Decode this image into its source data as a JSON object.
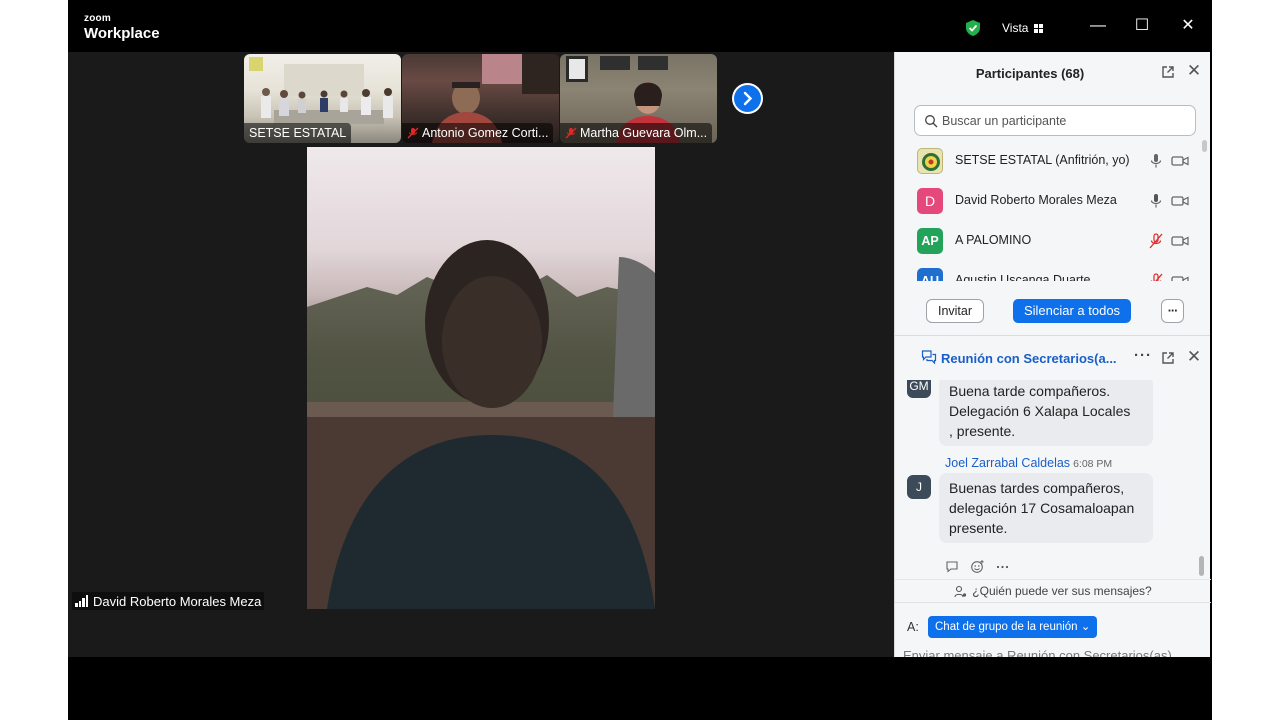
{
  "app": {
    "logo_top": "zoom",
    "logo_bottom": "Workplace",
    "view_label": "Vista",
    "minimize": "—",
    "maximize": "☐",
    "close": "✕",
    "accent_color": "#0e71eb",
    "secure_icon": "shield-check-icon"
  },
  "gallery": {
    "thumbnails": [
      {
        "name": "SETSE ESTATAL",
        "muted": false
      },
      {
        "name": "Antonio Gomez Corti...",
        "muted": true
      },
      {
        "name": "Martha Guevara Olm...",
        "muted": true
      }
    ],
    "next_icon": "chevron-right-icon"
  },
  "main_video": {
    "speaker_name": "David Roberto Morales Meza"
  },
  "participants": {
    "title": "Participantes (68)",
    "search_placeholder": "Buscar un participante",
    "list": [
      {
        "name": "SETSE ESTATAL (Anfitrión, yo)",
        "initials": "",
        "avatar_color": "#e9e3b0",
        "mic": "on",
        "video": "off"
      },
      {
        "name": "David Roberto Morales Meza",
        "initials": "D",
        "avatar_color": "#e5487a",
        "mic": "on",
        "video": "off"
      },
      {
        "name": "A PALOMINO",
        "initials": "AP",
        "avatar_color": "#23a35a",
        "mic": "muted",
        "video": "off"
      },
      {
        "name": "Agustin Uscanga Duarte",
        "initials": "AU",
        "avatar_color": "#1f6fd1",
        "mic": "muted",
        "video": "off"
      }
    ],
    "invite_label": "Invitar",
    "mute_all_label": "Silenciar a todos",
    "more_label": "···"
  },
  "chat": {
    "title": "Reunión con Secretarios(a...",
    "more_label": "···",
    "messages": [
      {
        "initials": "GM",
        "sender": "",
        "time": "",
        "lines": [
          "Buena tarde compañeros.",
          "Delegación 6 Xalapa Locales",
          ", presente."
        ]
      },
      {
        "initials": "J",
        "sender": "Joel Zarrabal Caldelas",
        "time": "6:08 PM",
        "lines": [
          "Buenas tardes compañeros,",
          "delegación 17 Cosamaloapan",
          "presente."
        ]
      }
    ],
    "who_sees": "¿Quién puede ver sus mensajes?",
    "to_label": "A:",
    "to_value": "Chat de grupo de la reunión ⌄",
    "input_placeholder": "Enviar mensaje a Reunión con Secretarios(as)"
  }
}
